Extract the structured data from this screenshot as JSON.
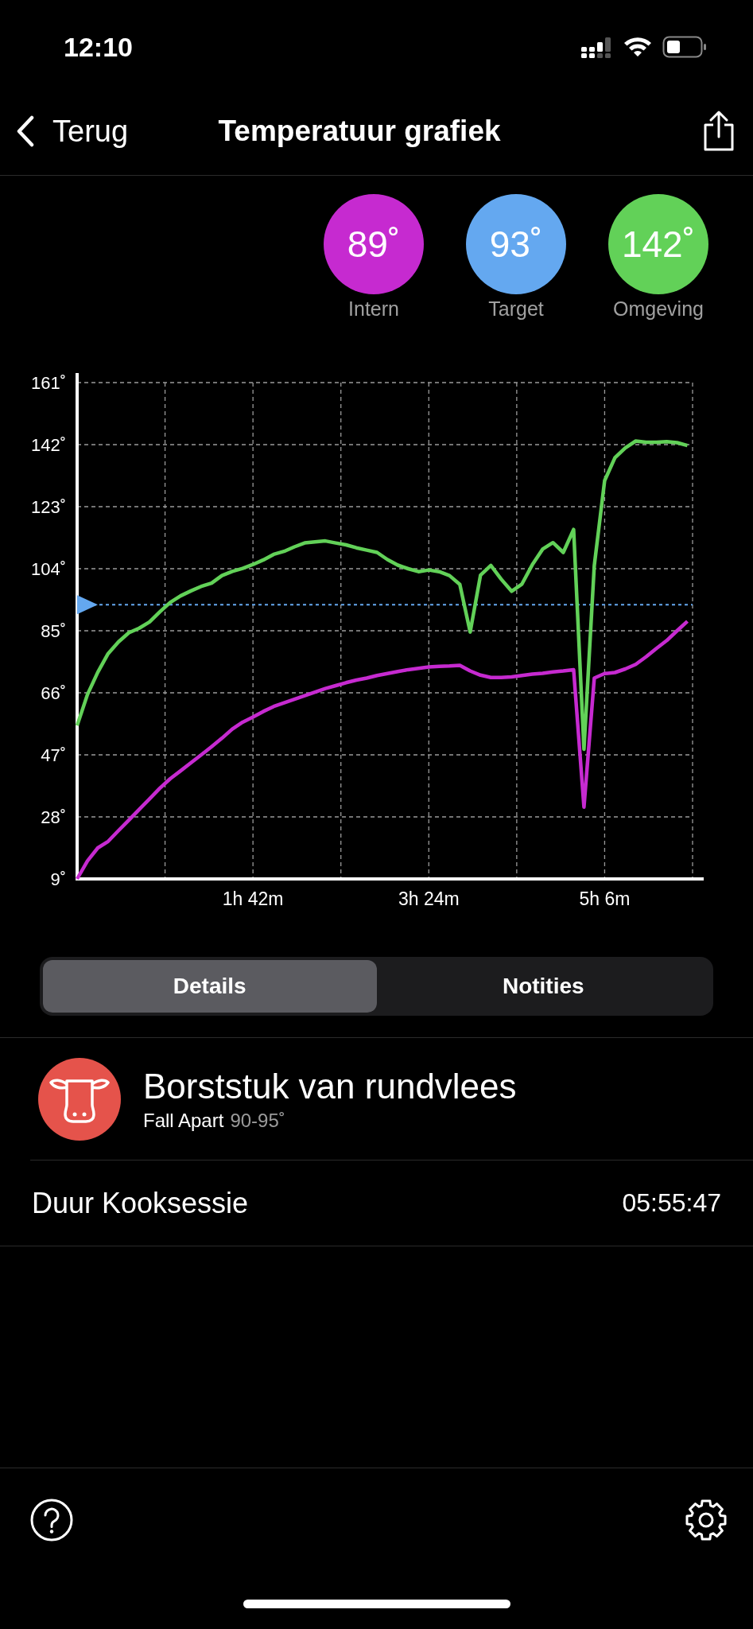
{
  "status_bar": {
    "time": "12:10"
  },
  "nav": {
    "back": "Terug",
    "title": "Temperatuur grafiek"
  },
  "readings": [
    {
      "value": "89˚",
      "label": "Intern",
      "color": "#c62ad0"
    },
    {
      "value": "93˚",
      "label": "Target",
      "color": "#64a8f0"
    },
    {
      "value": "142˚",
      "label": "Omgeving",
      "color": "#62d158"
    }
  ],
  "chart": {
    "chart_data": {
      "type": "line",
      "categories": [
        null,
        null,
        null,
        null,
        null,
        null,
        null,
        null,
        null,
        null,
        null,
        null,
        null,
        null,
        null,
        null,
        null,
        "1h 42m",
        null,
        null,
        null,
        null,
        null,
        null,
        null,
        null,
        null,
        null,
        null,
        null,
        null,
        null,
        null,
        null,
        "3h 24m",
        null,
        null,
        null,
        null,
        null,
        null,
        null,
        null,
        null,
        null,
        null,
        null,
        null,
        null,
        null,
        null,
        "5h 6m",
        null,
        null,
        null,
        null,
        null,
        null,
        null,
        null
      ],
      "series": [
        {
          "color": "#62d158",
          "values": [
            56,
            65.5,
            72.3,
            78,
            81.6,
            84.4,
            85.8,
            87.7,
            90.8,
            93.7,
            95.7,
            97.2,
            98.6,
            99.6,
            101.9,
            103.2,
            104.1,
            105.3,
            106.7,
            108.4,
            109.3,
            110.7,
            111.9,
            112.2,
            112.5,
            111.9,
            111.3,
            110.4,
            109.7,
            109,
            106.8,
            105.1,
            104,
            103.1,
            103.6,
            103.1,
            101.9,
            99.2,
            84.6,
            102,
            105,
            100.8,
            97.1,
            99.3,
            105.2,
            110,
            112,
            109,
            116,
            48.7,
            105,
            131,
            138,
            141,
            143.1,
            142.7,
            142.7,
            142.9,
            142.6,
            141.7
          ]
        },
        {
          "color": "#c62ad0",
          "values": [
            9,
            14.5,
            18.5,
            20.5,
            23.8,
            27,
            30.3,
            33.5,
            36.8,
            39.7,
            42.1,
            44.6,
            47,
            49.5,
            52.1,
            54.9,
            57,
            58.6,
            60.3,
            61.8,
            62.9,
            64,
            65.1,
            66.2,
            67.3,
            68.2,
            69.1,
            69.9,
            70.5,
            71.3,
            71.9,
            72.5,
            73.1,
            73.5,
            73.9,
            74.1,
            74.2,
            74.4,
            72.7,
            71.4,
            70.7,
            70.7,
            70.9,
            71.3,
            71.7,
            72,
            72.4,
            72.7,
            73.1,
            31,
            70.5,
            71.9,
            72.2,
            73.3,
            74.7,
            77,
            79.6,
            82,
            85,
            87.9
          ]
        }
      ],
      "ylim": [
        9,
        161
      ],
      "yticks": [
        {
          "value": 9,
          "label": "9˚"
        },
        {
          "value": 28,
          "label": "28˚"
        },
        {
          "value": 47,
          "label": "47˚"
        },
        {
          "value": 66,
          "label": "66˚"
        },
        {
          "value": 85,
          "label": "85˚"
        },
        {
          "value": 104,
          "label": "104˚"
        },
        {
          "value": 123,
          "label": "123˚"
        },
        {
          "value": 142,
          "label": "142˚"
        },
        {
          "value": 161,
          "label": "161˚"
        }
      ],
      "grid": true,
      "ref_lines": [
        {
          "axis": "y",
          "value": 93,
          "color": "#64a8f0"
        }
      ]
    }
  },
  "tabs": [
    {
      "label": "Details",
      "selected": true
    },
    {
      "label": "Notities",
      "selected": false
    }
  ],
  "product": {
    "name": "Borststuk van rundvlees",
    "doneness": "Fall Apart",
    "range": "90-95˚",
    "color": "#e5534b"
  },
  "duration": {
    "label": "Duur Kooksessie",
    "value": "05:55:47"
  }
}
